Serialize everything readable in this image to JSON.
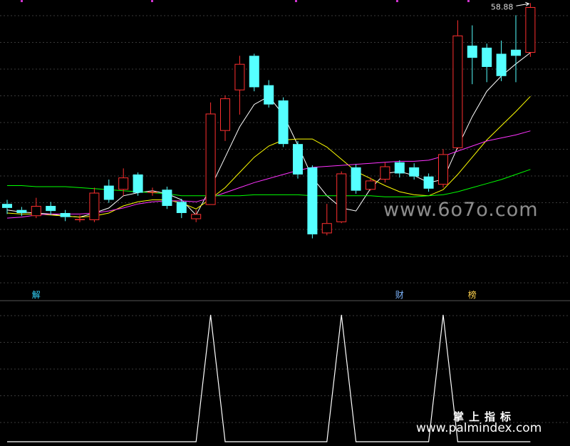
{
  "chart_data": {
    "type": "candlestick",
    "price_axis": {
      "min": 30.0,
      "max": 59.5,
      "grid": true
    },
    "indicator_axis": {
      "min": 0,
      "max": 1,
      "grid": true
    },
    "candles": [
      {
        "o": 39.4,
        "c": 39.0,
        "h": 39.8,
        "l": 38.4
      },
      {
        "o": 38.8,
        "c": 38.5,
        "h": 39.1,
        "l": 38.2
      },
      {
        "o": 38.2,
        "c": 39.2,
        "h": 40.0,
        "l": 38.0
      },
      {
        "o": 39.2,
        "c": 38.7,
        "h": 39.6,
        "l": 38.3
      },
      {
        "o": 38.5,
        "c": 38.1,
        "h": 38.8,
        "l": 37.7
      },
      {
        "o": 37.9,
        "c": 37.9,
        "h": 38.3,
        "l": 37.6
      },
      {
        "o": 37.8,
        "c": 40.5,
        "h": 41.0,
        "l": 37.6
      },
      {
        "o": 41.2,
        "c": 39.8,
        "h": 41.8,
        "l": 39.5
      },
      {
        "o": 40.8,
        "c": 42.0,
        "h": 42.9,
        "l": 40.2
      },
      {
        "o": 42.3,
        "c": 40.5,
        "h": 42.5,
        "l": 40.2
      },
      {
        "o": 40.6,
        "c": 40.6,
        "h": 41.0,
        "l": 40.2
      },
      {
        "o": 40.8,
        "c": 39.2,
        "h": 41.1,
        "l": 38.9
      },
      {
        "o": 39.6,
        "c": 38.5,
        "h": 39.9,
        "l": 38.0
      },
      {
        "o": 37.9,
        "c": 38.4,
        "h": 38.8,
        "l": 37.6
      },
      {
        "o": 39.3,
        "c": 48.3,
        "h": 49.4,
        "l": 39.3
      },
      {
        "o": 46.6,
        "c": 49.8,
        "h": 50.1,
        "l": 45.6
      },
      {
        "o": 50.6,
        "c": 53.2,
        "h": 54.0,
        "l": 48.2
      },
      {
        "o": 54.0,
        "c": 50.9,
        "h": 54.2,
        "l": 50.5
      },
      {
        "o": 51.1,
        "c": 49.2,
        "h": 51.6,
        "l": 48.9
      },
      {
        "o": 49.6,
        "c": 45.3,
        "h": 49.9,
        "l": 45.0
      },
      {
        "o": 45.3,
        "c": 42.3,
        "h": 45.6,
        "l": 41.9
      },
      {
        "o": 43.0,
        "c": 36.4,
        "h": 43.2,
        "l": 36.0
      },
      {
        "o": 36.5,
        "c": 37.5,
        "h": 39.4,
        "l": 36.3
      },
      {
        "o": 37.6,
        "c": 42.4,
        "h": 42.6,
        "l": 37.5
      },
      {
        "o": 43.0,
        "c": 40.7,
        "h": 43.3,
        "l": 40.4
      },
      {
        "o": 40.8,
        "c": 41.7,
        "h": 42.0,
        "l": 40.7
      },
      {
        "o": 41.8,
        "c": 43.1,
        "h": 43.5,
        "l": 41.5
      },
      {
        "o": 43.5,
        "c": 42.4,
        "h": 43.7,
        "l": 42.0
      },
      {
        "o": 43.0,
        "c": 42.1,
        "h": 43.4,
        "l": 41.8
      },
      {
        "o": 42.1,
        "c": 40.9,
        "h": 42.4,
        "l": 40.6
      },
      {
        "o": 41.3,
        "c": 44.3,
        "h": 44.8,
        "l": 41.0
      },
      {
        "o": 44.9,
        "c": 56.0,
        "h": 57.5,
        "l": 44.8
      },
      {
        "o": 55.0,
        "c": 53.8,
        "h": 57.0,
        "l": 51.2
      },
      {
        "o": 54.8,
        "c": 52.9,
        "h": 55.2,
        "l": 51.4
      },
      {
        "o": 54.2,
        "c": 52.0,
        "h": 55.5,
        "l": 51.5
      },
      {
        "o": 54.6,
        "c": 54.0,
        "h": 58.0,
        "l": 51.4
      },
      {
        "o": 54.3,
        "c": 58.8,
        "h": 59.2,
        "l": 53.9
      }
    ],
    "ma_series": [
      {
        "color": "#ffffff",
        "values": [
          38.8,
          38.6,
          38.5,
          38.4,
          38.2,
          38.1,
          38.5,
          39.0,
          40.2,
          40.5,
          40.7,
          40.4,
          39.8,
          38.3,
          41.0,
          44.0,
          47.0,
          49.2,
          50.0,
          48.2,
          45.2,
          42.0,
          40.2,
          39.0,
          38.7,
          40.9,
          42.4,
          42.6,
          42.2,
          41.5,
          41.8,
          45.0,
          48.0,
          50.5,
          52.0,
          53.2,
          54.3
        ]
      },
      {
        "color": "#ffff00",
        "values": [
          38.5,
          38.4,
          38.4,
          38.3,
          38.2,
          38.1,
          38.2,
          38.5,
          39.2,
          39.6,
          39.8,
          39.8,
          39.5,
          38.9,
          39.9,
          41.0,
          42.5,
          44.0,
          45.1,
          45.7,
          45.8,
          45.8,
          45.0,
          43.8,
          42.6,
          41.9,
          41.2,
          40.6,
          40.3,
          40.2,
          40.8,
          42.3,
          44.0,
          45.7,
          47.1,
          48.5,
          50.0
        ]
      },
      {
        "color": "#ff33ff",
        "values": [
          38.0,
          38.1,
          38.3,
          38.4,
          38.4,
          38.4,
          38.5,
          38.7,
          39.0,
          39.4,
          39.6,
          39.7,
          39.7,
          39.6,
          40.0,
          40.5,
          41.0,
          41.5,
          41.9,
          42.3,
          42.7,
          43.0,
          43.1,
          43.2,
          43.3,
          43.4,
          43.5,
          43.6,
          43.6,
          43.7,
          44.1,
          44.6,
          45.1,
          45.6,
          45.9,
          46.2,
          46.6
        ]
      },
      {
        "color": "#00ff00",
        "values": [
          41.2,
          41.2,
          41.1,
          41.1,
          41.1,
          41.0,
          40.9,
          40.8,
          40.7,
          40.6,
          40.5,
          40.4,
          40.2,
          40.2,
          40.2,
          40.2,
          40.2,
          40.3,
          40.3,
          40.3,
          40.3,
          40.2,
          40.2,
          40.2,
          40.2,
          40.2,
          40.1,
          40.1,
          40.1,
          40.2,
          40.3,
          40.6,
          41.0,
          41.4,
          41.8,
          42.3,
          42.8
        ]
      }
    ],
    "annotations": [
      {
        "label": "解",
        "index": 2,
        "color": "#33d6ff"
      },
      {
        "label": "财",
        "index": 27,
        "color": "#7fb6ff"
      },
      {
        "label": "榜",
        "index": 32,
        "color": "#ffd24d"
      }
    ],
    "high_label": "58.88",
    "indicator_values": [
      0,
      0,
      0,
      0,
      0,
      0,
      0,
      0,
      0,
      0,
      0,
      0,
      0,
      0,
      1,
      0,
      0,
      0,
      0,
      0,
      0,
      0,
      0,
      1,
      0,
      0,
      0,
      0,
      0,
      0,
      1,
      0,
      0,
      0,
      0,
      0,
      0
    ],
    "colors": {
      "up": "#ff3030",
      "down": "#55ffff",
      "grid": "#3a3a3a",
      "indicator": "#ffffff",
      "label": "#dddddd"
    }
  },
  "watermark": {
    "top_text": "掌上指标",
    "url_text": "www.palmindex.com",
    "mid_text": "www.6o7o.com"
  }
}
